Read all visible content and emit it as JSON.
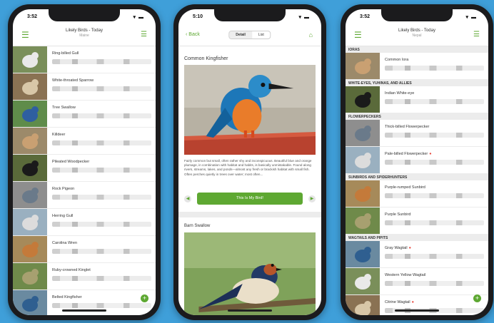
{
  "phone1": {
    "time": "3:52",
    "signal": "▾ ▬",
    "title": "Likely Birds - Today",
    "subtitle": "Maine",
    "birds": [
      {
        "name": "Ring-billed Gull"
      },
      {
        "name": "White-throated Sparrow"
      },
      {
        "name": "Tree Swallow"
      },
      {
        "name": "Killdeer"
      },
      {
        "name": "Pileated Woodpecker"
      },
      {
        "name": "Rock Pigeon"
      },
      {
        "name": "Herring Gull"
      },
      {
        "name": "Carolina Wren"
      },
      {
        "name": "Ruby-crowned Kinglet"
      },
      {
        "name": "Belted Kingfisher"
      }
    ]
  },
  "phone2": {
    "time": "5:10",
    "back_label": "Back",
    "seg_detail": "Detail",
    "seg_list": "List",
    "bird1": "Common Kingfisher",
    "description": "Fairly common but small, often rather shy and inconspicuous. Beautiful blue and orange plumage, in combination with habitat and habits, is basically unmistakable. Found along rivers, streams, lakes, and ponds—almost any fresh or brackish habitat with small fish. Often perches quietly in trees over water; most often...",
    "button": "This Is My Bird!",
    "bird2": "Barn Swallow"
  },
  "phone3": {
    "time": "3:52",
    "title": "Likely Birds - Today",
    "subtitle": "Nepal",
    "groups": [
      {
        "header": "IORAS",
        "birds": [
          {
            "name": "Common Iora",
            "star": false
          }
        ]
      },
      {
        "header": "WHITE-EYES, YUHINAS, AND ALLIES",
        "birds": [
          {
            "name": "Indian White-eye",
            "star": false
          }
        ]
      },
      {
        "header": "FLOWERPECKERS",
        "birds": [
          {
            "name": "Thick-billed Flowerpecker",
            "star": false
          },
          {
            "name": "Pale-billed Flowerpecker",
            "star": true
          }
        ]
      },
      {
        "header": "SUNBIRDS AND SPIDERHUNTERS",
        "birds": [
          {
            "name": "Purple-rumped Sunbird",
            "star": false
          },
          {
            "name": "Purple Sunbird",
            "star": false
          }
        ]
      },
      {
        "header": "WAGTAILS AND PIPITS",
        "birds": [
          {
            "name": "Gray Wagtail",
            "star": true
          },
          {
            "name": "Western Yellow Wagtail",
            "star": false
          },
          {
            "name": "Citrine Wagtail",
            "star": true
          }
        ]
      }
    ]
  },
  "colors": {
    "accent": "#5ea832",
    "background": "#3f9fd9",
    "star": "#e8473d"
  }
}
